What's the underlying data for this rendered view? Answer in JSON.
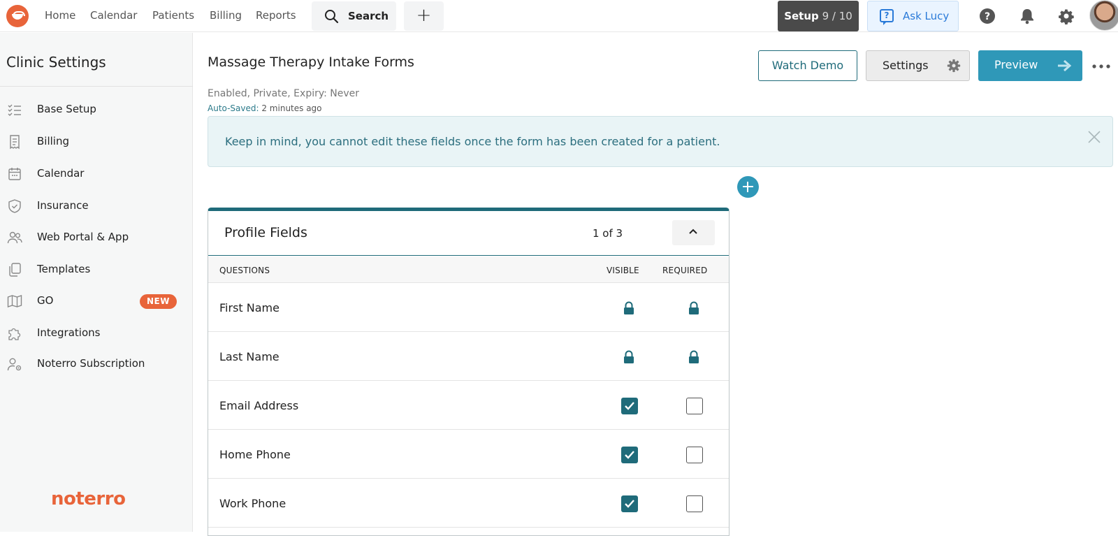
{
  "nav": {
    "links": [
      "Home",
      "Calendar",
      "Patients",
      "Billing",
      "Reports"
    ],
    "search_label": "Search",
    "add_label": "+",
    "setup_label": "Setup",
    "setup_count": "9 / 10",
    "ask_label": "Ask Lucy",
    "icons": [
      "help-icon",
      "bell-icon",
      "gear-icon"
    ]
  },
  "sidebar": {
    "title": "Clinic Settings",
    "items": [
      {
        "label": "Base Setup",
        "icon": "checklist-icon"
      },
      {
        "label": "Billing",
        "icon": "receipt-icon"
      },
      {
        "label": "Calendar",
        "icon": "calendar-icon"
      },
      {
        "label": "Insurance",
        "icon": "shield-icon"
      },
      {
        "label": "Web Portal & App",
        "icon": "users-icon"
      },
      {
        "label": "Templates",
        "icon": "copy-icon"
      },
      {
        "label": "GO",
        "icon": "map-icon",
        "badge": "NEW"
      },
      {
        "label": "Integrations",
        "icon": "puzzle-icon"
      },
      {
        "label": "Noterro Subscription",
        "icon": "user-gear-icon"
      }
    ],
    "brand": "noterro"
  },
  "form": {
    "title": "Massage Therapy Intake Forms",
    "status": "Enabled, Private, Expiry: Never",
    "autosave_label": "Auto-Saved:",
    "autosave_time": "2 minutes ago",
    "buttons": {
      "watch": "Watch Demo",
      "settings": "Settings",
      "preview": "Preview"
    },
    "alert": "Keep in mind, you cannot edit these fields once the form has been created for a patient."
  },
  "section": {
    "title": "Profile Fields",
    "count": "1 of 3",
    "columns": {
      "questions": "QUESTIONS",
      "visible": "VISIBLE",
      "required": "REQUIRED"
    },
    "rows": [
      {
        "question": "First Name",
        "visible": "locked",
        "required": "locked"
      },
      {
        "question": "Last Name",
        "visible": "locked",
        "required": "locked"
      },
      {
        "question": "Email Address",
        "visible": "checked",
        "required": "unchecked"
      },
      {
        "question": "Home Phone",
        "visible": "checked",
        "required": "unchecked"
      },
      {
        "question": "Work Phone",
        "visible": "checked",
        "required": "unchecked"
      }
    ]
  },
  "colors": {
    "brand": "#e8643a",
    "primary": "#1f6b7a",
    "accent": "#2f98b8",
    "alert_bg": "#e9f4f6"
  }
}
